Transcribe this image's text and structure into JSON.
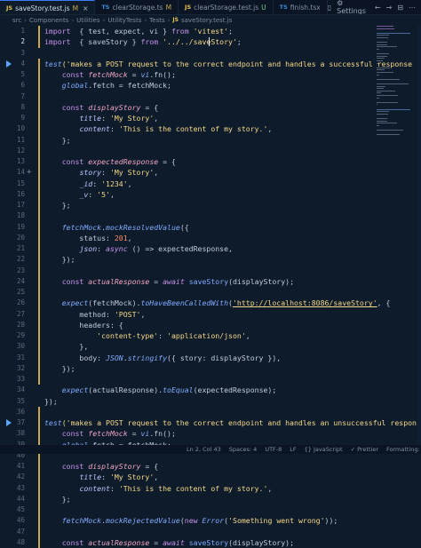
{
  "tabs": [
    {
      "icon": "JS",
      "label": "saveStory.test.js",
      "mark": "M",
      "active": true
    },
    {
      "icon": "TS",
      "label": "clearStorage.ts",
      "mark": "M"
    },
    {
      "icon": "JS",
      "label": "clearStorage.test.js",
      "mark": "U"
    },
    {
      "icon": "TS",
      "label": "finish.tsx",
      "mark": ""
    }
  ],
  "tab_tools": {
    "settings_label": "Settings"
  },
  "breadcrumb": [
    "src",
    "Components",
    "Utilities",
    "UtilityTests",
    "Tests",
    "saveStory.test.js"
  ],
  "breadcrumb_icon": "JS",
  "editor": {
    "current_line": 2,
    "lines": [
      {
        "n": 1,
        "t": [
          [
            "kw",
            "import"
          ],
          [
            "",
            "  { test, expect, vi } "
          ],
          [
            "kw",
            "from"
          ],
          [
            "str",
            " 'vitest'"
          ],
          [
            "",
            ";"
          ]
        ]
      },
      {
        "n": 2,
        "t": [
          [
            "kw",
            "import"
          ],
          [
            "",
            "  { saveStory } "
          ],
          [
            "kw",
            "from"
          ],
          [
            "str",
            " '../../saveStory'"
          ],
          [
            "",
            ";"
          ]
        ]
      },
      {
        "n": 3,
        "t": []
      },
      {
        "n": 4,
        "run": true,
        "t": [
          [
            "fn it",
            "test"
          ],
          [
            "str",
            "('makes a POST request to the correct endpoint and handles a successful response"
          ]
        ]
      },
      {
        "n": 5,
        "t": [
          [
            "",
            "    "
          ],
          [
            "kw",
            "const"
          ],
          [
            "var it",
            " fetchMock"
          ],
          [
            "",
            " = "
          ],
          [
            "fn it",
            "vi"
          ],
          [
            "",
            ".fn();"
          ]
        ]
      },
      {
        "n": 6,
        "t": [
          [
            "",
            "    "
          ],
          [
            "fn it",
            "global"
          ],
          [
            "",
            ".fetch = fetchMock;"
          ]
        ]
      },
      {
        "n": 7,
        "t": []
      },
      {
        "n": 8,
        "t": [
          [
            "",
            "    "
          ],
          [
            "kw",
            "const"
          ],
          [
            "var it",
            " displayStory"
          ],
          [
            "",
            " = {"
          ]
        ]
      },
      {
        "n": 9,
        "t": [
          [
            "",
            "        "
          ],
          [
            "prop it",
            "title"
          ],
          [
            "",
            ": "
          ],
          [
            "str",
            "'My Story'"
          ],
          [
            "",
            ","
          ]
        ]
      },
      {
        "n": 10,
        "t": [
          [
            "",
            "        "
          ],
          [
            "prop it",
            "content"
          ],
          [
            "",
            ": "
          ],
          [
            "str",
            "'This is the content of my story.'"
          ],
          [
            "",
            ","
          ]
        ]
      },
      {
        "n": 11,
        "t": [
          [
            "",
            "    };"
          ]
        ]
      },
      {
        "n": 12,
        "t": []
      },
      {
        "n": 13,
        "t": [
          [
            "",
            "    "
          ],
          [
            "kw",
            "const"
          ],
          [
            "var it",
            " expectedResponse"
          ],
          [
            "",
            " = {"
          ]
        ]
      },
      {
        "n": 14,
        "plus": true,
        "t": [
          [
            "",
            "        "
          ],
          [
            "prop it",
            "story"
          ],
          [
            "",
            ": "
          ],
          [
            "str",
            "'My Story'"
          ],
          [
            "",
            ","
          ]
        ]
      },
      {
        "n": 15,
        "t": [
          [
            "",
            "        "
          ],
          [
            "prop it",
            "_id"
          ],
          [
            "",
            ": "
          ],
          [
            "str",
            "'1234'"
          ],
          [
            "",
            ","
          ]
        ]
      },
      {
        "n": 16,
        "t": [
          [
            "",
            "        "
          ],
          [
            "prop it",
            "_v"
          ],
          [
            "",
            ": "
          ],
          [
            "str",
            "'5'"
          ],
          [
            "",
            ","
          ]
        ]
      },
      {
        "n": 17,
        "t": [
          [
            "",
            "    };"
          ]
        ]
      },
      {
        "n": 18,
        "t": []
      },
      {
        "n": 19,
        "t": [
          [
            "",
            "    "
          ],
          [
            "fn it",
            "fetchMock"
          ],
          [
            "",
            "."
          ],
          [
            "fn it",
            "mockResolvedValue"
          ],
          [
            "",
            "({"
          ]
        ]
      },
      {
        "n": 20,
        "t": [
          [
            "",
            "        status: "
          ],
          [
            "num",
            "201"
          ],
          [
            "",
            ","
          ]
        ]
      },
      {
        "n": 21,
        "t": [
          [
            "",
            "        "
          ],
          [
            "prop it",
            "json"
          ],
          [
            "",
            ": "
          ],
          [
            "kw it",
            "async"
          ],
          [
            "",
            " () => expectedResponse,"
          ]
        ]
      },
      {
        "n": 22,
        "t": [
          [
            "",
            "    });"
          ]
        ]
      },
      {
        "n": 23,
        "t": []
      },
      {
        "n": 24,
        "t": [
          [
            "",
            "    "
          ],
          [
            "kw",
            "const"
          ],
          [
            "var it",
            " actualResponse"
          ],
          [
            "",
            " = "
          ],
          [
            "kw it",
            "await"
          ],
          [
            "fn",
            " saveStory"
          ],
          [
            "",
            "(displayStory);"
          ]
        ]
      },
      {
        "n": 25,
        "t": []
      },
      {
        "n": 26,
        "t": [
          [
            "",
            "    "
          ],
          [
            "fn it",
            "expect"
          ],
          [
            "",
            "(fetchMock)."
          ],
          [
            "fn it",
            "toHaveBeenCalledWith"
          ],
          [
            "",
            "("
          ],
          [
            "url",
            "'http://localhost:8086/saveStory'"
          ],
          [
            "",
            ", {"
          ]
        ]
      },
      {
        "n": 27,
        "t": [
          [
            "",
            "        method: "
          ],
          [
            "str",
            "'POST'"
          ],
          [
            "",
            ","
          ]
        ]
      },
      {
        "n": 28,
        "t": [
          [
            "",
            "        headers: {"
          ]
        ]
      },
      {
        "n": 29,
        "t": [
          [
            "",
            "            "
          ],
          [
            "str",
            "'content-type'"
          ],
          [
            "",
            ": "
          ],
          [
            "str",
            "'application/json'"
          ],
          [
            "",
            ","
          ]
        ]
      },
      {
        "n": 30,
        "t": [
          [
            "",
            "        },"
          ]
        ]
      },
      {
        "n": 31,
        "t": [
          [
            "",
            "        body: "
          ],
          [
            "fn it",
            "JSON"
          ],
          [
            "",
            "."
          ],
          [
            "fn it",
            "stringify"
          ],
          [
            "",
            "({ story: displayStory }),"
          ]
        ]
      },
      {
        "n": 32,
        "t": [
          [
            "",
            "    });"
          ]
        ]
      },
      {
        "n": 33,
        "t": []
      },
      {
        "n": 34,
        "t": [
          [
            "",
            "    "
          ],
          [
            "fn it",
            "expect"
          ],
          [
            "",
            "(actualResponse)."
          ],
          [
            "fn it",
            "toEqual"
          ],
          [
            "",
            "(expectedResponse);"
          ]
        ]
      },
      {
        "n": 35,
        "t": [
          [
            "",
            "});"
          ]
        ]
      },
      {
        "n": 36,
        "t": []
      },
      {
        "n": 37,
        "run": true,
        "t": [
          [
            "fn it",
            "test"
          ],
          [
            "str",
            "('makes a POST request to the correct endpoint and handles an unsuccessful respon"
          ]
        ]
      },
      {
        "n": 38,
        "t": [
          [
            "",
            "    "
          ],
          [
            "kw",
            "const"
          ],
          [
            "var it",
            " fetchMock"
          ],
          [
            "",
            " = "
          ],
          [
            "fn it",
            "vi"
          ],
          [
            "",
            ".fn();"
          ]
        ]
      },
      {
        "n": 39,
        "t": [
          [
            "",
            "    "
          ],
          [
            "fn it",
            "global"
          ],
          [
            "",
            ".fetch = fetchMock;"
          ]
        ]
      },
      {
        "n": 40,
        "t": []
      },
      {
        "n": 41,
        "t": [
          [
            "",
            "    "
          ],
          [
            "kw",
            "const"
          ],
          [
            "var it",
            " displayStory"
          ],
          [
            "",
            " = {"
          ]
        ]
      },
      {
        "n": 42,
        "t": [
          [
            "",
            "        "
          ],
          [
            "prop it",
            "title"
          ],
          [
            "",
            ": "
          ],
          [
            "str",
            "'My Story'"
          ],
          [
            "",
            ","
          ]
        ]
      },
      {
        "n": 43,
        "t": [
          [
            "",
            "        "
          ],
          [
            "prop it",
            "content"
          ],
          [
            "",
            ": "
          ],
          [
            "str",
            "'This is the content of my story.'"
          ],
          [
            "",
            ","
          ]
        ]
      },
      {
        "n": 44,
        "t": [
          [
            "",
            "    };"
          ]
        ]
      },
      {
        "n": 45,
        "t": []
      },
      {
        "n": 46,
        "t": [
          [
            "",
            "    "
          ],
          [
            "fn it",
            "fetchMock"
          ],
          [
            "",
            "."
          ],
          [
            "fn it",
            "mockRejectedValue"
          ],
          [
            "",
            "("
          ],
          [
            "kw",
            "new"
          ],
          [
            "fn it",
            " Error"
          ],
          [
            "",
            "("
          ],
          [
            "str",
            "'Something went wrong'"
          ],
          [
            "",
            "));"
          ]
        ]
      },
      {
        "n": 47,
        "t": []
      },
      {
        "n": 48,
        "t": [
          [
            "",
            "    "
          ],
          [
            "kw",
            "const"
          ],
          [
            "var it",
            " actualResponse"
          ],
          [
            "",
            " = "
          ],
          [
            "kw it",
            "await"
          ],
          [
            "fn",
            " saveStory"
          ],
          [
            "",
            "(displayStory);"
          ]
        ]
      }
    ]
  },
  "status": [
    "Ln 2, Col 43",
    "Spaces: 4",
    "UTF-8",
    "LF",
    "{} JavaScript",
    "✓ Prettier",
    "Formatting: ✓"
  ],
  "colors": {
    "background": "#0d1b2a",
    "accent": "#3d7cff",
    "keyword": "#c792ea",
    "string": "#f7d98b",
    "function": "#82aaff"
  }
}
